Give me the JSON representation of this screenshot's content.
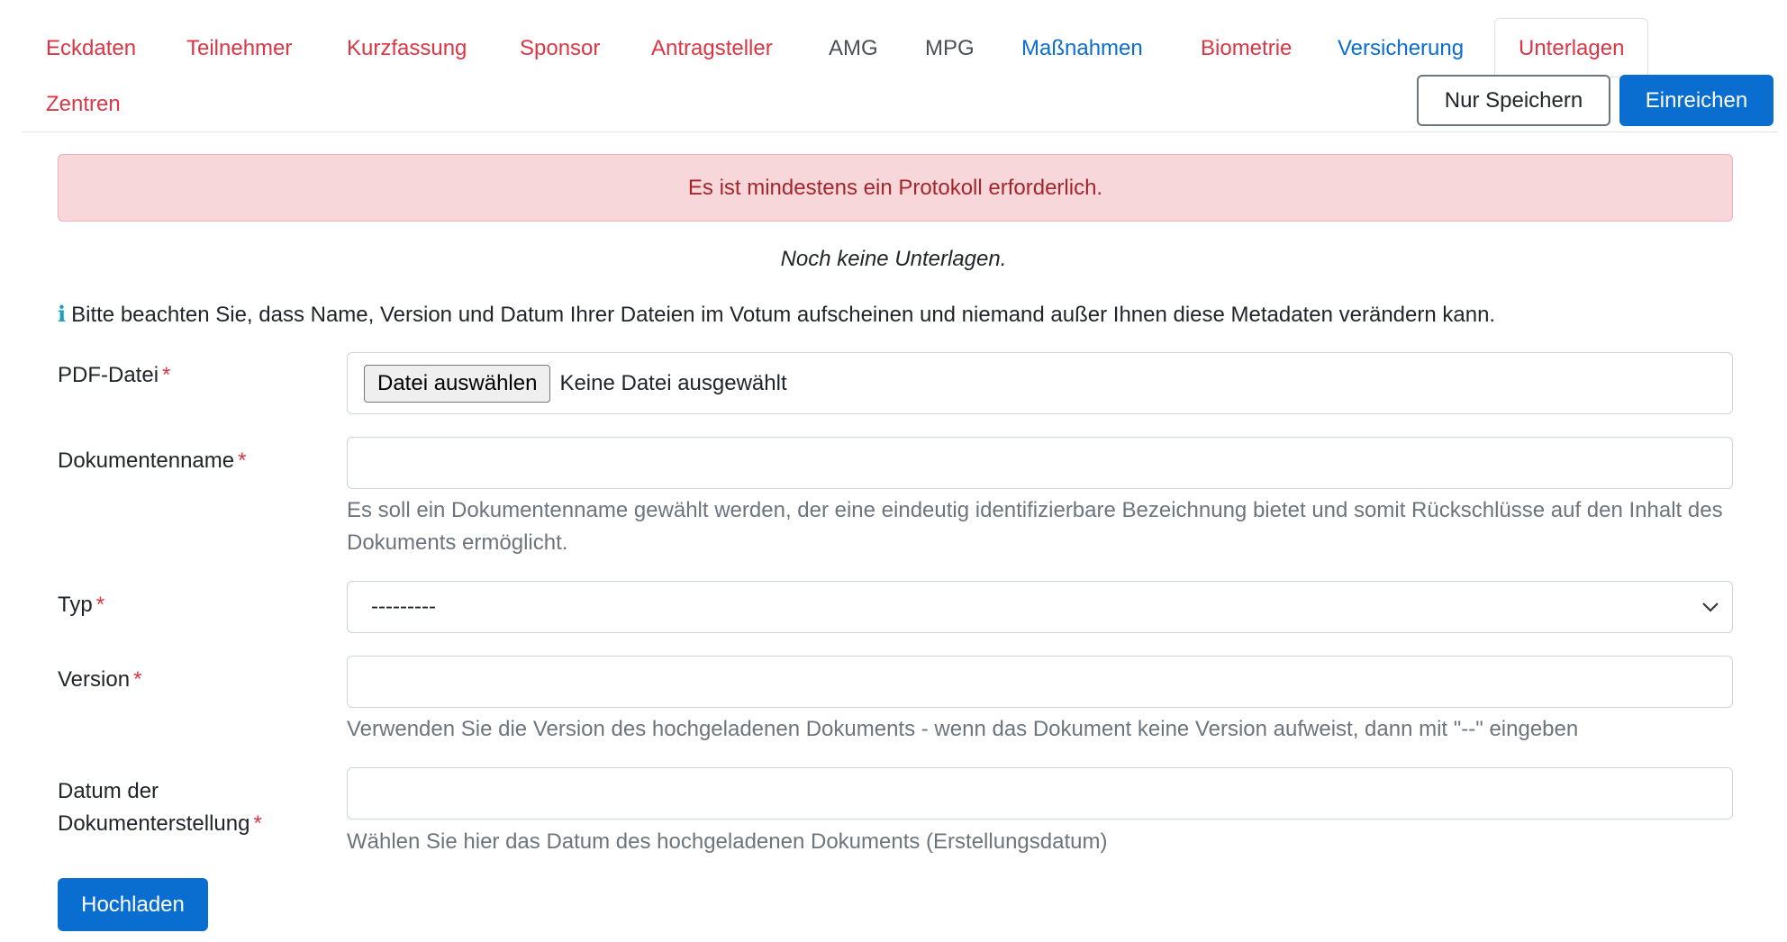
{
  "tabs": [
    {
      "label": "Eckdaten",
      "state": "error"
    },
    {
      "label": "Teilnehmer",
      "state": "error"
    },
    {
      "label": "Kurzfassung",
      "state": "error"
    },
    {
      "label": "Sponsor",
      "state": "error"
    },
    {
      "label": "Antragsteller",
      "state": "error"
    },
    {
      "label": "AMG",
      "state": "neutral"
    },
    {
      "label": "MPG",
      "state": "neutral"
    },
    {
      "label": "Maßnahmen",
      "state": "ok"
    },
    {
      "label": "Biometrie",
      "state": "error"
    },
    {
      "label": "Versicherung",
      "state": "ok"
    },
    {
      "label": "Unterlagen",
      "state": "active-error"
    },
    {
      "label": "Zentren",
      "state": "error"
    }
  ],
  "actions": {
    "save_label": "Nur Speichern",
    "submit_label": "Einreichen"
  },
  "alert": {
    "message": "Es ist mindestens ein Protokoll erforderlich."
  },
  "documents": {
    "empty_message": "Noch keine Unterlagen."
  },
  "info": {
    "icon": "i",
    "text": "Bitte beachten Sie, dass Name, Version und Datum Ihrer Dateien im Votum aufscheinen und niemand außer Ihnen diese Metadaten verändern kann."
  },
  "form": {
    "required_marker": "*",
    "pdf": {
      "label": "PDF-Datei",
      "button_label": "Datei auswählen",
      "status": "Keine Datei ausgewählt"
    },
    "name": {
      "label": "Dokumentenname",
      "value": "",
      "help": "Es soll ein Dokumentenname gewählt werden, der eine eindeutig identifizierbare Bezeichnung bietet und somit Rückschlüsse auf den Inhalt des Dokuments ermöglicht."
    },
    "type": {
      "label": "Typ",
      "selected": "---------"
    },
    "version": {
      "label": "Version",
      "value": "",
      "help": "Verwenden Sie die Version des hochgeladenen Dokuments - wenn das Dokument keine Version aufweist, dann mit \"--\" eingeben"
    },
    "date": {
      "label_line1": "Datum der",
      "label_line2": "Dokumenterstellung",
      "value": "",
      "help": "Wählen Sie hier das Datum des hochgeladenen Dokuments (Erstellungsdatum)"
    },
    "upload_label": "Hochladen"
  },
  "colors": {
    "error": "#dc3545",
    "ok": "#0a6ed1",
    "neutral": "#495057",
    "alert_bg": "#f8d7da"
  }
}
